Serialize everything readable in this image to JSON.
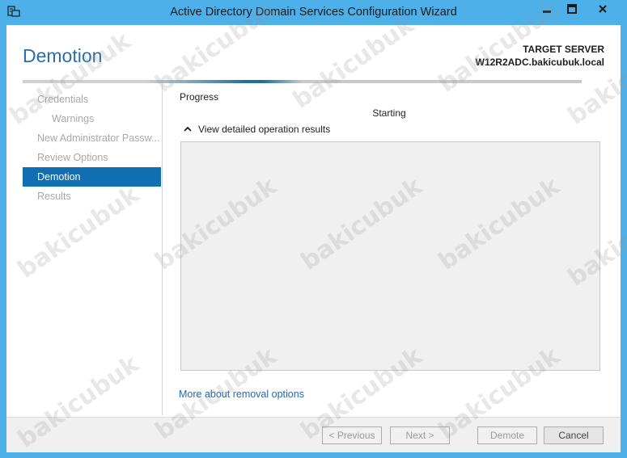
{
  "window": {
    "title": "Active Directory Domain Services Configuration Wizard"
  },
  "header": {
    "page_title": "Demotion",
    "target_label": "TARGET SERVER",
    "target_server": "W12R2ADC.bakicubuk.local"
  },
  "nav": {
    "items": [
      {
        "label": "Credentials"
      },
      {
        "label": "Warnings"
      },
      {
        "label": "New Administrator Passw..."
      },
      {
        "label": "Review Options"
      },
      {
        "label": "Demotion"
      },
      {
        "label": "Results"
      }
    ]
  },
  "main": {
    "section_label": "Progress",
    "status": "Starting",
    "details_toggle": "View detailed operation results",
    "more_link": "More about removal options"
  },
  "footer": {
    "previous": "< Previous",
    "next": "Next >",
    "demote": "Demote",
    "cancel": "Cancel"
  },
  "watermark": {
    "text": "bakicubuk"
  },
  "colors": {
    "frame": "#4db0e8",
    "accent": "#0f6fb0",
    "title_blue": "#2c6fa6",
    "link": "#1e6bb8"
  }
}
